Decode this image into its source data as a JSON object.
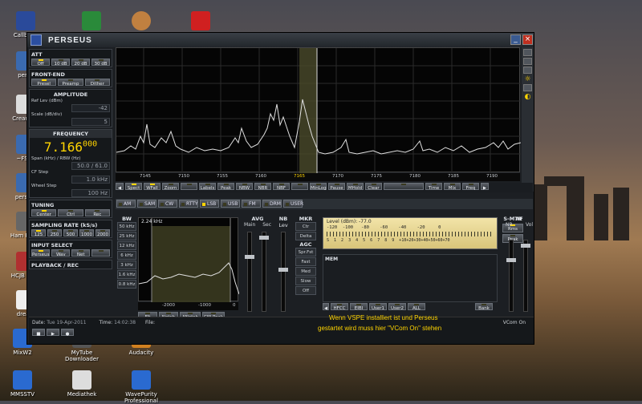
{
  "desktop": {
    "icons": [
      {
        "label": "Callbook"
      },
      {
        "label": "perse"
      },
      {
        "label": "Cream Pe"
      },
      {
        "label": "~FSpe"
      },
      {
        "label": "perse.b"
      },
      {
        "label": "Ham Radio"
      },
      {
        "label": "HCJB Popp"
      },
      {
        "label": "dream"
      },
      {
        "label": "MixW2"
      },
      {
        "label": "MyTube Downloader"
      },
      {
        "label": "Audacity"
      },
      {
        "label": "MMSSTV"
      },
      {
        "label": "Mediathek"
      },
      {
        "label": "WavePurity Professional"
      }
    ]
  },
  "window": {
    "title": "PERSEUS"
  },
  "left": {
    "att": {
      "title": "ATT",
      "buttons": [
        "Off",
        "10 dB",
        "20 dB",
        "30 dB"
      ]
    },
    "frontend": {
      "title": "FRONT-END",
      "buttons": [
        "Presel",
        "Preamp",
        "Dither"
      ]
    },
    "amplitude": {
      "title": "AMPLITUDE",
      "ref_label": "Ref Lev (dBm)",
      "ref_value": "-42",
      "scale_label": "Scale (dB/div)",
      "scale_value": "5"
    },
    "frequency": {
      "title": "FREQUENCY",
      "main": "7.166",
      "sub": "000",
      "span_label": "Span (kHz) / RBW (Hz)",
      "span_value": "50.0 / 61.0",
      "cf_label": "CF Step",
      "cf_value": "1.0 kHz",
      "wheel_label": "Wheel Step",
      "wheel_value": "100 Hz"
    },
    "tuning": {
      "title": "TUNING",
      "buttons": [
        "Center",
        "Ctrl",
        "Rec"
      ]
    },
    "sampling": {
      "title": "SAMPLING RATE (kS/s)",
      "buttons": [
        "125",
        "250",
        "500",
        "1000",
        "2000"
      ]
    },
    "input": {
      "title": "INPUT SELECT",
      "buttons": [
        "Perseus",
        "Wav",
        "Net",
        ""
      ]
    },
    "playback": {
      "title": "PLAYBACK / REC"
    }
  },
  "spectrum": {
    "ticks": [
      "7145",
      "7150",
      "7155",
      "7160",
      "7165",
      "7170",
      "7175",
      "7180",
      "7185",
      "7190"
    ],
    "toolbar": [
      "Spect",
      "WFall",
      "Zoom",
      "",
      "Labels",
      "Peak",
      "NBW",
      "NBR",
      "NBF",
      "",
      "MinLog",
      "Pause",
      "MHold",
      "Clear",
      "",
      "Time",
      "Mix",
      "Freq"
    ]
  },
  "modes": [
    "AM",
    "SAM",
    "CW",
    "RTTY",
    "LSB",
    "USB",
    "FM",
    "DRM",
    "USER"
  ],
  "lower": {
    "bw_title": "BW",
    "bw_value": "2.24 kHz",
    "bw_buttons": [
      "50 kHz",
      "25 kHz",
      "12 kHz",
      "6 kHz",
      "3 kHz",
      "1.6 kHz",
      "0.8 kHz"
    ],
    "filter_ticks": [
      "-2000",
      "-1000",
      "0"
    ],
    "filter_buttons": [
      "Flt",
      "Notch",
      "ANotch",
      "CW-Peak"
    ],
    "avg": {
      "title": "AVG",
      "main": "Main",
      "sec": "Sec"
    },
    "nb": {
      "title": "NB",
      "lev": "Lev"
    },
    "mkr": {
      "title": "MKR",
      "buttons": [
        "Ctr",
        "Delta"
      ]
    },
    "agc": {
      "title": "AGC",
      "buttons": [
        "Spr.Fst",
        "Fast",
        "Med",
        "Slow",
        "Off"
      ]
    },
    "meter": {
      "level_label": "Level (dBm):",
      "level_value": "-77.0",
      "scale_top": "-120  -100   -80    -60    -40    -20     0",
      "scale_bottom": "S  1  2  3  4  5  6  7  8  9  +10+20+30+40+50+60+70"
    },
    "mem_title": "MEM",
    "mem_buttons": [
      "HFCC",
      "EIBI",
      "User1",
      "User2",
      "ALL",
      "Bank"
    ],
    "smtr": {
      "title": "S-MTR",
      "buttons": [
        "Rms",
        "Peak"
      ]
    },
    "af": {
      "title": "AF",
      "nr": "NR",
      "vol": "Vol"
    }
  },
  "status": {
    "date_label": "Date:",
    "date_value": "Tue 19-Apr-2011",
    "time_label": "Time:",
    "time_value": "14:02:38",
    "file_label": "File:",
    "vcom": "VCom On",
    "note_line1": "Wenn VSPE installiert ist und Perseus",
    "note_line2": "gestartet wird muss hier \"VCom On\" stehen"
  }
}
